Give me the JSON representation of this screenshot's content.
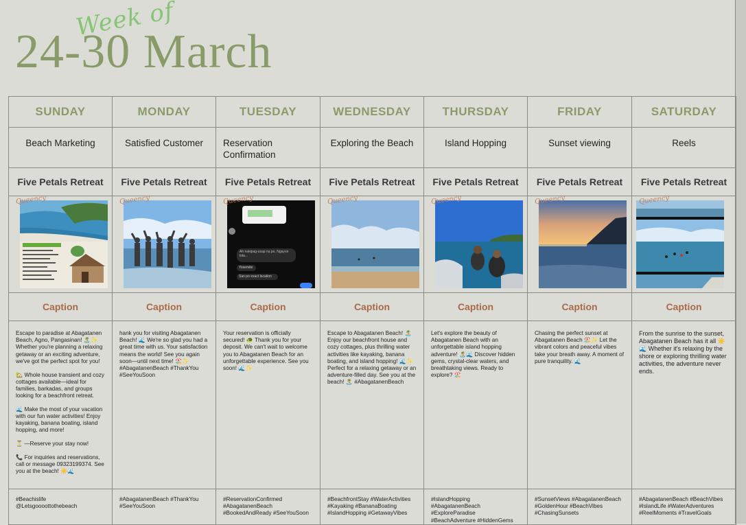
{
  "header": {
    "week_of": "Week of",
    "range": "24-30 March"
  },
  "watermark": "Queency",
  "caption_heading": "Caption",
  "days": [
    {
      "name": "SUNDAY",
      "topic": "Beach Marketing",
      "page": "Five Petals Retreat",
      "caption": [
        "Escape to paradise at Abagatanen Beach, Agno, Pangasinan! 🏝️✨ Whether you're planning a relaxing getaway or an exciting adventure, we've got the perfect spot for you!",
        "🏡 Whole house transient and cozy cottages available—ideal for families, barkadas, and groups looking for a beachfront retreat.",
        "🌊 Make the most of your vacation with our fun water activities! Enjoy kayaking, banana boating, island hopping, and more!",
        "⏳ —Reserve your stay now!",
        "📞 For inquiries and reservations, call or message 09323199374. See you at the beach! ☀️🌊"
      ],
      "tags": "#Beachislife @Letsgoooottothebeach"
    },
    {
      "name": "MONDAY",
      "topic": "Satisfied Customer",
      "page": "Five Petals Retreat",
      "caption": [
        "hank you for visiting Abagatanen Beach! 🌊 We're so glad you had a great time with us. Your satisfaction means the world! See you again soon—until next time! 🏖️✨ #AbagatanenBeach #ThankYou #SeeYouSoon"
      ],
      "tags": "#AbagatanenBeach #ThankYou #SeeYouSoon"
    },
    {
      "name": "TUESDAY",
      "topic": "Reservation Confirmation",
      "page": "Five Petals Retreat",
      "caption": [
        "Your reservation is officially secured! 🐢 Thank you for your deposit. We can't wait to welcome you to Abagatanen Beach for an unforgettable experience. See you soon! 🌊✨"
      ],
      "tags": "#ReservationConfirmed #AbagatanenBeach #BookedAndReady #SeeYouSoon",
      "chat": [
        "Ah nakipag-usap na po, Ngayon kita...",
        "Yosemite",
        "San po exact location"
      ]
    },
    {
      "name": "WEDNESDAY",
      "topic": "Exploring the Beach",
      "page": "Five Petals Retreat",
      "caption": [
        "Escape to Abagatanen Beach! 🏝️ Enjoy our beachfront house and cozy cottages, plus thrilling water activities like kayaking, banana boating, and island hopping! 🌊✨ Perfect for a relaxing getaway or an adventure-filled day. See you at the beach! 🏝️ #AbagatanenBeach"
      ],
      "tags": "#BeachfrontStay #WaterActivities #Kayaking #BananaBoating #IslandHopping #GetawayVibes"
    },
    {
      "name": "THURSDAY",
      "topic": "Island Hopping",
      "page": "Five Petals Retreat",
      "caption": [
        "Let's explore the beauty of Abagatanen Beach with an unforgettable island hopping adventure! 🏝️🌊 Discover hidden gems, crystal-clear waters, and breathtaking views. Ready to explore? 🏖️"
      ],
      "tags": "#IslandHopping #AbagatanenBeach #ExploreParadise #BeachAdventure #HiddenGems"
    },
    {
      "name": "FRIDAY",
      "topic": "Sunset viewing",
      "page": "Five Petals Retreat",
      "caption": [
        "Chasing the perfect sunset at Abagatanen Beach 🏖️✨ Let the vibrant colors and peaceful vibes take your breath away. A moment of pure tranquility. 🌊"
      ],
      "tags": "#SunsetViews #AbagatanenBeach #GoldenHour #BeachVibes #ChasingSunsets"
    },
    {
      "name": "SATURDAY",
      "topic": "Reels",
      "page": "Five Petals Retreat",
      "caption": [
        "From the sunrise to the sunset, Abagatanen Beach has it all ☀️ 🌊 Whether it's relaxing by the shore or exploring thrilling water activities, the adventure never ends."
      ],
      "tags": "#AbagatanenBeach #BeachVibes #IslandLife #WaterAdventures #ReelMoments #TravelGoals"
    }
  ],
  "colors": {
    "accent_green": "#8a9b6a",
    "script_green": "#86c476",
    "caption_brown": "#a86a4a",
    "background": "#dcdcd6"
  }
}
